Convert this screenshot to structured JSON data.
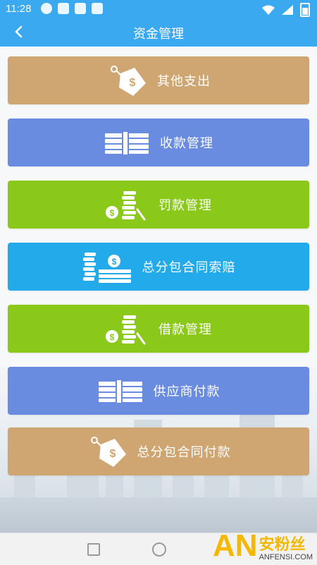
{
  "status_bar": {
    "time": "11:28"
  },
  "header": {
    "back_icon": "arrow-left-icon",
    "title": "资金管理"
  },
  "menu": [
    {
      "label": "其他支出",
      "icon": "price-tag-dollar-icon",
      "color": "#cfa672"
    },
    {
      "label": "收款管理",
      "icon": "cash-stack-icon",
      "color": "#6a8ce0"
    },
    {
      "label": "罚款管理",
      "icon": "coin-stack-dollar-icon",
      "color": "#8ac91a"
    },
    {
      "label": "总分包合同索赔",
      "icon": "coins-and-cash-icon",
      "color": "#22aaeb"
    },
    {
      "label": "借款管理",
      "icon": "coin-stack-dollar-icon",
      "color": "#8ac91a"
    },
    {
      "label": "供应商付款",
      "icon": "cash-stack-icon",
      "color": "#6a8ce0"
    },
    {
      "label": "总分包合同付款",
      "icon": "price-tag-dollar-icon",
      "color": "#cfa672"
    }
  ],
  "navigation": {
    "recent_icon": "recent-apps-icon",
    "home_icon": "home-icon"
  },
  "watermark": {
    "logo": "AN",
    "cn": "安粉丝",
    "en": "ANFENSI.COM"
  }
}
